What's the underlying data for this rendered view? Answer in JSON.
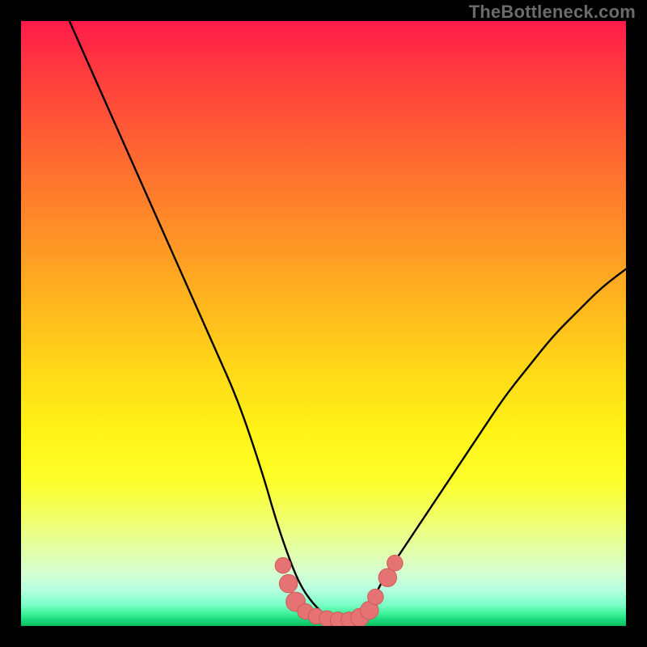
{
  "watermark": "TheBottleneck.com",
  "chart_data": {
    "type": "line",
    "title": "",
    "xlabel": "",
    "ylabel": "",
    "xlim": [
      0,
      100
    ],
    "ylim": [
      0,
      100
    ],
    "grid": false,
    "legend": false,
    "series": [
      {
        "name": "bottleneck-curve",
        "x": [
          8,
          12,
          16,
          20,
          24,
          28,
          32,
          36,
          40,
          42,
          44,
          46,
          48,
          50,
          52,
          54,
          56,
          58,
          60,
          64,
          68,
          72,
          76,
          80,
          84,
          88,
          92,
          96,
          100
        ],
        "y": [
          100,
          91,
          82,
          73,
          64,
          55,
          46,
          37,
          25,
          18,
          12,
          7,
          4,
          2,
          1,
          1,
          2,
          4,
          8,
          14,
          20,
          26,
          32,
          38,
          43,
          48,
          52,
          56,
          59
        ]
      }
    ],
    "markers": [
      {
        "name": "marker",
        "x": 43.3,
        "y": 10,
        "r": 1.3
      },
      {
        "name": "marker",
        "x": 44.2,
        "y": 7.0,
        "r": 1.5
      },
      {
        "name": "marker",
        "x": 45.4,
        "y": 4.0,
        "r": 1.6
      },
      {
        "name": "marker",
        "x": 47.0,
        "y": 2.4,
        "r": 1.3
      },
      {
        "name": "marker",
        "x": 48.8,
        "y": 1.6,
        "r": 1.3
      },
      {
        "name": "marker",
        "x": 50.6,
        "y": 1.2,
        "r": 1.3
      },
      {
        "name": "marker",
        "x": 52.4,
        "y": 1.0,
        "r": 1.3
      },
      {
        "name": "marker",
        "x": 54.2,
        "y": 1.0,
        "r": 1.3
      },
      {
        "name": "marker",
        "x": 56.0,
        "y": 1.4,
        "r": 1.5
      },
      {
        "name": "marker",
        "x": 57.6,
        "y": 2.6,
        "r": 1.5
      },
      {
        "name": "marker",
        "x": 58.6,
        "y": 4.8,
        "r": 1.3
      },
      {
        "name": "marker",
        "x": 60.6,
        "y": 8.0,
        "r": 1.5
      },
      {
        "name": "marker",
        "x": 61.8,
        "y": 10.4,
        "r": 1.3
      }
    ],
    "colors": {
      "curve": "#000000",
      "marker_fill": "#e57373",
      "marker_stroke": "#cf5a5a"
    }
  }
}
